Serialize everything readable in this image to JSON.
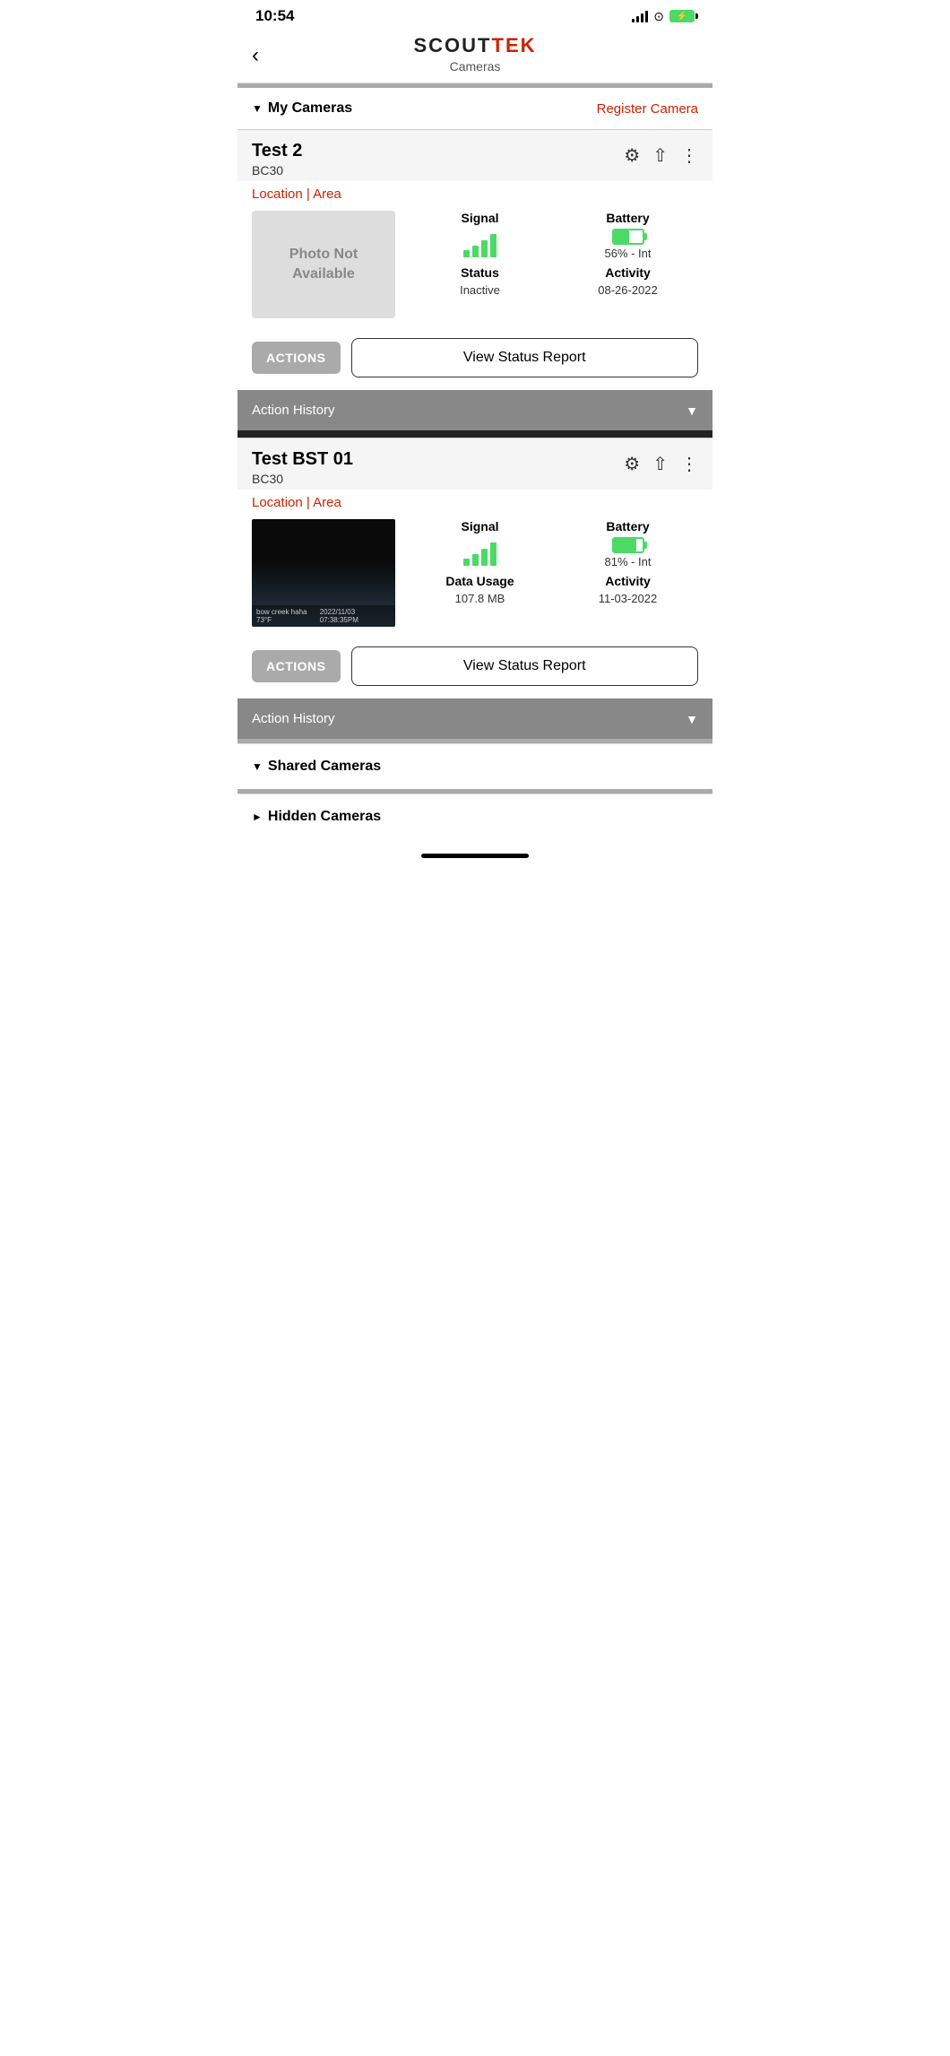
{
  "statusBar": {
    "time": "10:54",
    "signalBars": [
      4,
      7,
      10,
      13
    ],
    "batteryPercent": 70
  },
  "header": {
    "logoLeft": "SCOUT",
    "logoRight": "TEK",
    "subtitle": "Cameras",
    "backLabel": "‹"
  },
  "myCameras": {
    "label": "My Cameras",
    "registerLabel": "Register Camera",
    "arrowIcon": "▼"
  },
  "cameras": [
    {
      "id": "camera-test2",
      "name": "Test 2",
      "model": "BC30",
      "locationLabel": "Location | Area",
      "hasPhoto": false,
      "photoUnavailableText": "Photo Not\nAvailable",
      "signal": {
        "label": "Signal",
        "bars": 4
      },
      "battery": {
        "label": "Battery",
        "percent": 56,
        "type": "Int",
        "displayText": "56% - Int"
      },
      "statusLabel": "Status",
      "statusValue": "Inactive",
      "activityLabel": "Activity",
      "activityValue": "08-26-2022",
      "actionsButtonLabel": "ACTIONS",
      "viewStatusLabel": "View Status Report",
      "actionHistoryLabel": "Action History"
    },
    {
      "id": "camera-test-bst-01",
      "name": "Test BST 01",
      "model": "BC30",
      "locationLabel": "Location | Area",
      "hasPhoto": true,
      "photoOverlayLeft": "bow creek  haha  73°F",
      "photoOverlayRight": "2022/11/03  07:38:35PM",
      "signal": {
        "label": "Signal",
        "bars": 4
      },
      "battery": {
        "label": "Battery",
        "percent": 81,
        "type": "Int",
        "displayText": "81% - Int"
      },
      "dataUsageLabel": "Data Usage",
      "dataUsageValue": "107.8 MB",
      "activityLabel": "Activity",
      "activityValue": "11-03-2022",
      "actionsButtonLabel": "ACTIONS",
      "viewStatusLabel": "View Status Report",
      "actionHistoryLabel": "Action History"
    }
  ],
  "sharedCameras": {
    "label": "Shared Cameras",
    "arrowIcon": "▼"
  },
  "hiddenCameras": {
    "label": "Hidden Cameras",
    "arrowIcon": "►"
  }
}
